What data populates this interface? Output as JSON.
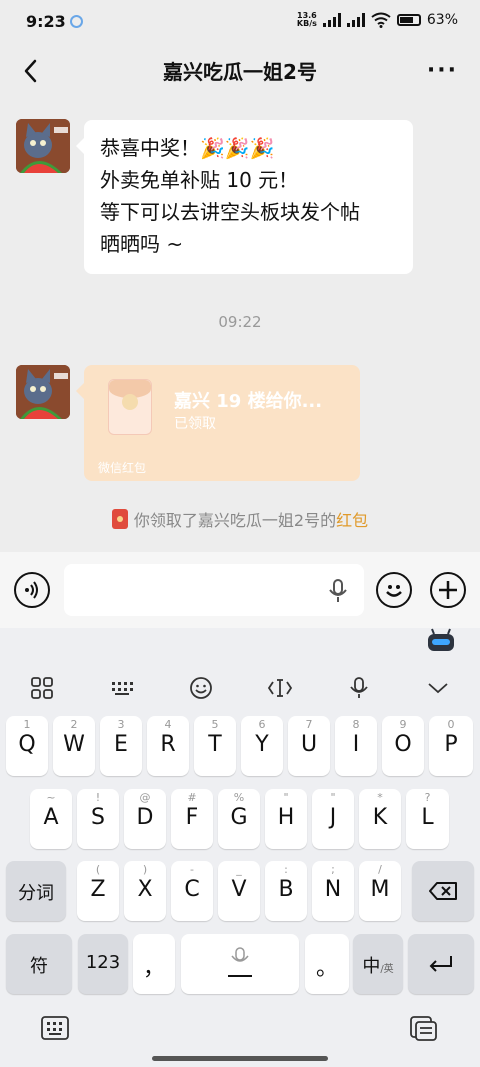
{
  "status_bar": {
    "time": "9:23",
    "net_speed_top": "13.6",
    "net_speed_bottom": "KB/s",
    "battery": "63%"
  },
  "nav": {
    "title": "嘉兴吃瓜一姐2号",
    "more": "···"
  },
  "message": {
    "lines": [
      "恭喜中奖！🎉🎉🎉",
      "外卖免单补贴 10 元！",
      "等下可以去讲空头板块发个帖",
      "晒晒吗 ~"
    ]
  },
  "timestamp": "09:22",
  "red_packet": {
    "title": "嘉兴 19 楼给你...",
    "status": "已领取",
    "footer": "微信红包",
    "seal": "¥"
  },
  "notice": {
    "text": "你领取了嘉兴吃瓜一姐2号的",
    "link": "红包"
  },
  "input": {
    "placeholder": ""
  },
  "keyboard": {
    "row1": [
      {
        "main": "Q",
        "sub": "1"
      },
      {
        "main": "W",
        "sub": "2"
      },
      {
        "main": "E",
        "sub": "3"
      },
      {
        "main": "R",
        "sub": "4"
      },
      {
        "main": "T",
        "sub": "5"
      },
      {
        "main": "Y",
        "sub": "6"
      },
      {
        "main": "U",
        "sub": "7"
      },
      {
        "main": "I",
        "sub": "8"
      },
      {
        "main": "O",
        "sub": "9"
      },
      {
        "main": "P",
        "sub": "0"
      }
    ],
    "row2": [
      {
        "main": "A",
        "sub": "~"
      },
      {
        "main": "S",
        "sub": "!"
      },
      {
        "main": "D",
        "sub": "@"
      },
      {
        "main": "F",
        "sub": "#"
      },
      {
        "main": "G",
        "sub": "%"
      },
      {
        "main": "H",
        "sub": "\""
      },
      {
        "main": "J",
        "sub": "\""
      },
      {
        "main": "K",
        "sub": "*"
      },
      {
        "main": "L",
        "sub": "?"
      }
    ],
    "row3": [
      {
        "main": "Z",
        "sub": "("
      },
      {
        "main": "X",
        "sub": ")"
      },
      {
        "main": "C",
        "sub": "-"
      },
      {
        "main": "V",
        "sub": "_"
      },
      {
        "main": "B",
        "sub": ":"
      },
      {
        "main": "N",
        "sub": ";"
      },
      {
        "main": "M",
        "sub": "/"
      }
    ],
    "fenci": "分词",
    "symbols": "符",
    "numbers": "123",
    "comma": "，",
    "period": "。",
    "lang_main": "中",
    "lang_sub": "/英"
  }
}
